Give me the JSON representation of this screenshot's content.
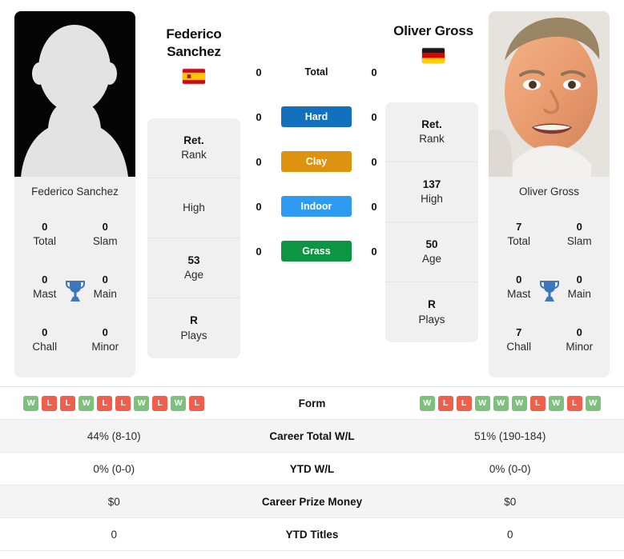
{
  "players": {
    "left": {
      "name": "Federico Sanchez",
      "name_line1": "Federico",
      "name_line2": "Sanchez",
      "country": "Spain",
      "flag_icon": "flag-spain-icon",
      "photo_icon": "avatar-placeholder-icon",
      "titles": {
        "total_value": "0",
        "total_label": "Total",
        "slam_value": "0",
        "slam_label": "Slam",
        "mast_value": "0",
        "mast_label": "Mast",
        "main_value": "0",
        "main_label": "Main",
        "chall_value": "0",
        "chall_label": "Chall",
        "minor_value": "0",
        "minor_label": "Minor"
      },
      "info": [
        {
          "value": "Ret.",
          "label": "Rank"
        },
        {
          "value": "",
          "label": "High"
        },
        {
          "value": "53",
          "label": "Age"
        },
        {
          "value": "R",
          "label": "Plays"
        }
      ],
      "surface_values": [
        "0",
        "0",
        "0",
        "0",
        "0"
      ],
      "form": [
        "W",
        "L",
        "L",
        "W",
        "L",
        "L",
        "W",
        "L",
        "W",
        "L"
      ],
      "career_total_wl": "44% (8-10)",
      "ytd_wl": "0% (0-0)",
      "career_prize_money": "$0",
      "ytd_titles": "0"
    },
    "right": {
      "name": "Oliver Gross",
      "name_line1": "Oliver Gross",
      "name_line2": "",
      "country": "Germany",
      "flag_icon": "flag-germany-icon",
      "photo_icon": "player-photo",
      "titles": {
        "total_value": "7",
        "total_label": "Total",
        "slam_value": "0",
        "slam_label": "Slam",
        "mast_value": "0",
        "mast_label": "Mast",
        "main_value": "0",
        "main_label": "Main",
        "chall_value": "7",
        "chall_label": "Chall",
        "minor_value": "0",
        "minor_label": "Minor"
      },
      "info": [
        {
          "value": "Ret.",
          "label": "Rank"
        },
        {
          "value": "137",
          "label": "High"
        },
        {
          "value": "50",
          "label": "Age"
        },
        {
          "value": "R",
          "label": "Plays"
        }
      ],
      "surface_values": [
        "0",
        "0",
        "0",
        "0",
        "0"
      ],
      "form": [
        "W",
        "L",
        "L",
        "W",
        "W",
        "W",
        "L",
        "W",
        "L",
        "W"
      ],
      "career_total_wl": "51% (190-184)",
      "ytd_wl": "0% (0-0)",
      "career_prize_money": "$0",
      "ytd_titles": "0"
    }
  },
  "surfaces": [
    {
      "label": "Total",
      "style": "plain",
      "color": ""
    },
    {
      "label": "Hard",
      "style": "chip",
      "color": "#1270bd"
    },
    {
      "label": "Clay",
      "style": "chip",
      "color": "#dd9310"
    },
    {
      "label": "Indoor",
      "style": "chip",
      "color": "#2e9bf0"
    },
    {
      "label": "Grass",
      "style": "chip",
      "color": "#0d9544"
    }
  ],
  "stats_rows": [
    {
      "label": "Form",
      "key": "form",
      "type": "form"
    },
    {
      "label": "Career Total W/L",
      "key": "career_total_wl",
      "type": "text"
    },
    {
      "label": "YTD W/L",
      "key": "ytd_wl",
      "type": "text"
    },
    {
      "label": "Career Prize Money",
      "key": "career_prize_money",
      "type": "text"
    },
    {
      "label": "YTD Titles",
      "key": "ytd_titles",
      "type": "text"
    }
  ],
  "colors": {
    "win_badge": "#7dc17d",
    "loss_badge": "#ef5f4c",
    "card_bg": "#f0f0f0",
    "row_shade": "#f4f4f4",
    "trophy": "#3c76bd"
  },
  "trophy_icon": "trophy-icon"
}
